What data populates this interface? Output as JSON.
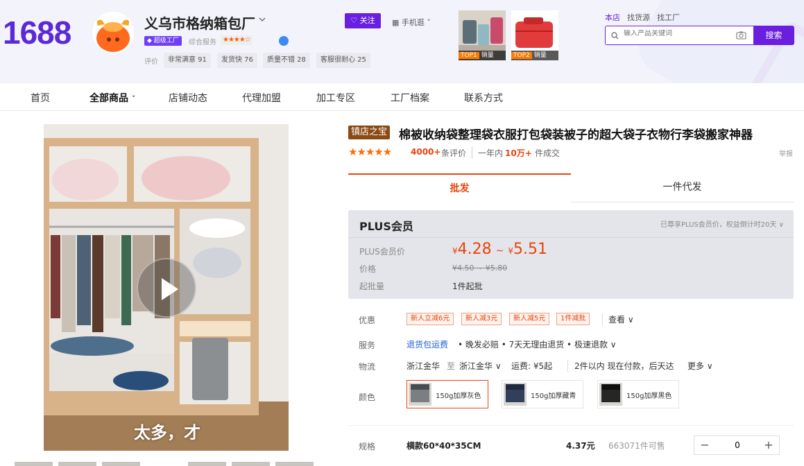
{
  "brand": {
    "logo_text": "1688"
  },
  "shop": {
    "name": "义乌市格纳箱包厂",
    "factory_badge": "超级工厂",
    "service_label": "综合服务",
    "service_stars": "★★★★☆",
    "follow_label": "关注",
    "mobile_label": "手机逛",
    "eval_label": "评价",
    "eval_tags": [
      "非常满意 91",
      "发货快 76",
      "质量不错 28",
      "客服很耐心 25"
    ]
  },
  "top_products": [
    {
      "rank": "TOP1",
      "label": "销量"
    },
    {
      "rank": "TOP2",
      "label": "销量"
    }
  ],
  "search": {
    "links": [
      "本店",
      "找货源",
      "找工厂"
    ],
    "placeholder": "输入产品关键词",
    "button": "搜索"
  },
  "nav": {
    "items": [
      "首页",
      "全部商品",
      "店铺动态",
      "代理加盟",
      "加工专区",
      "工厂档案",
      "联系方式"
    ]
  },
  "video": {
    "subtitle": "太多，才"
  },
  "product": {
    "badge": "镇店之宝",
    "title": "棉被收纳袋整理袋衣服打包袋装被子的超大袋子衣物行李袋搬家神器",
    "rating_stars": "★★★★★",
    "review_count": "4000+",
    "review_label": "条评价",
    "sold_year": "一年内",
    "sold_count": "10万+",
    "sold_label": "件成交",
    "report": "举报"
  },
  "tabs": {
    "wholesale": "批发",
    "dropship": "一件代发"
  },
  "plus": {
    "title": "PLUS会员",
    "note": "已尊享PLUS会员价，权益倒计时20天 ∨",
    "price_label": "PLUS会员价",
    "price_min": "4.28",
    "price_max": "5.51",
    "yen": "¥",
    "orig_label": "价格",
    "orig_price": "¥4.50 ~ ¥5.80",
    "moq_label": "起批量",
    "moq": "1件起批"
  },
  "discount": {
    "label": "优惠",
    "coupons": [
      "新人立减6元",
      "新人减3元",
      "新人减5元",
      "1件减批"
    ],
    "more": "查看 ∨"
  },
  "service": {
    "label": "服务",
    "link": "退货包运费",
    "text": "• 晚发必赔 • 7天无理由退货 • 极速退款 ∨"
  },
  "logistics": {
    "label": "物流",
    "from": "浙江金华",
    "to_label": "至",
    "to": "浙江金华 ∨",
    "fee": "运费: ¥5起",
    "time": "2件以内 现在付款，后天达",
    "more": "更多 ∨"
  },
  "color": {
    "label": "颜色",
    "options": [
      "150g加厚灰色",
      "150g加厚藏青",
      "150g加厚黑色"
    ]
  },
  "spec": {
    "label": "规格",
    "name": "横款60*40*35CM",
    "price": "4.37元",
    "stock": "663071件可售",
    "qty": "0",
    "minus": "−",
    "plus": "+"
  }
}
